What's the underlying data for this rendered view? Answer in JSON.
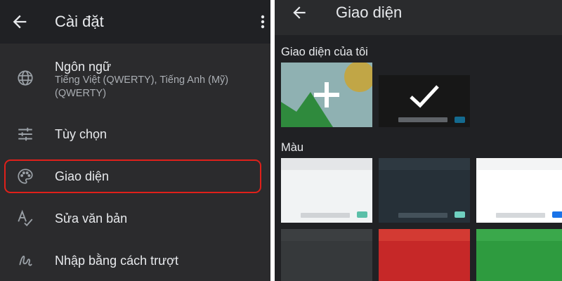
{
  "settings": {
    "title": "Cài đặt",
    "items": [
      {
        "label": "Ngôn ngữ",
        "subtitle": "Tiếng Việt (QWERTY), Tiếng Anh (Mỹ) (QWERTY)",
        "icon": "globe-icon"
      },
      {
        "label": "Tùy chọn",
        "icon": "sliders-icon"
      },
      {
        "label": "Giao diện",
        "icon": "palette-icon",
        "highlighted": true
      },
      {
        "label": "Sửa văn bản",
        "icon": "text-correction-icon"
      },
      {
        "label": "Nhập bằng cách trượt",
        "icon": "swipe-icon"
      }
    ]
  },
  "theme": {
    "title": "Giao diện",
    "my_themes_label": "Giao diện của tôi",
    "colors_label": "Màu"
  },
  "colors": {
    "accent_highlight": "#e0201a",
    "background_dark": "#202124",
    "text_primary": "#e8eaed"
  }
}
